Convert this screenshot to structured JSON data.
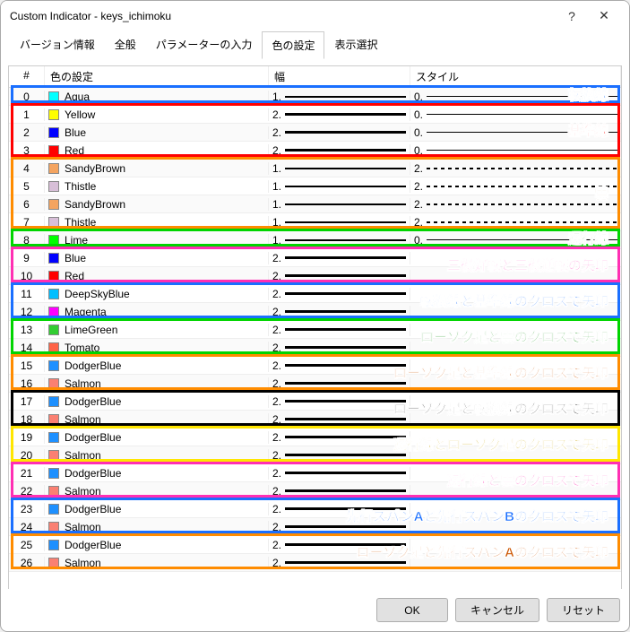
{
  "window": {
    "title": "Custom Indicator - keys_ichimoku"
  },
  "tabs": {
    "t0": "バージョン情報",
    "t1": "全般",
    "t2": "パラメーターの入力",
    "t3": "色の設定",
    "t4": "表示選択",
    "active": 3
  },
  "headers": {
    "num": "#",
    "color": "色の設定",
    "width": "幅",
    "style": "スタイル"
  },
  "rows": [
    {
      "n": "0",
      "name": "Aqua",
      "hex": "#00FFFF",
      "w": "1.",
      "wsz": 1,
      "s": "0.",
      "style": "solid"
    },
    {
      "n": "1",
      "name": "Yellow",
      "hex": "#FFFF00",
      "w": "2.",
      "wsz": 2,
      "s": "0.",
      "style": "solid"
    },
    {
      "n": "2",
      "name": "Blue",
      "hex": "#0000FF",
      "w": "2.",
      "wsz": 2,
      "s": "0.",
      "style": "solid"
    },
    {
      "n": "3",
      "name": "Red",
      "hex": "#FF0000",
      "w": "2.",
      "wsz": 2,
      "s": "0.",
      "style": "solid"
    },
    {
      "n": "4",
      "name": "SandyBrown",
      "hex": "#F4A460",
      "w": "1.",
      "wsz": 1,
      "s": "2.",
      "style": "dash"
    },
    {
      "n": "5",
      "name": "Thistle",
      "hex": "#D8BFD8",
      "w": "1.",
      "wsz": 1,
      "s": "2.",
      "style": "dash"
    },
    {
      "n": "6",
      "name": "SandyBrown",
      "hex": "#F4A460",
      "w": "1.",
      "wsz": 1,
      "s": "2.",
      "style": "dash"
    },
    {
      "n": "7",
      "name": "Thistle",
      "hex": "#D8BFD8",
      "w": "1.",
      "wsz": 1,
      "s": "2.",
      "style": "dash"
    },
    {
      "n": "8",
      "name": "Lime",
      "hex": "#00FF00",
      "w": "1.",
      "wsz": 1,
      "s": "0.",
      "style": "solid"
    },
    {
      "n": "9",
      "name": "Blue",
      "hex": "#0000FF",
      "w": "2.",
      "wsz": 2,
      "s": "",
      "style": ""
    },
    {
      "n": "10",
      "name": "Red",
      "hex": "#FF0000",
      "w": "2.",
      "wsz": 2,
      "s": "",
      "style": ""
    },
    {
      "n": "11",
      "name": "DeepSkyBlue",
      "hex": "#00BFFF",
      "w": "2.",
      "wsz": 2,
      "s": "",
      "style": ""
    },
    {
      "n": "12",
      "name": "Magenta",
      "hex": "#FF00FF",
      "w": "2.",
      "wsz": 2,
      "s": "",
      "style": ""
    },
    {
      "n": "13",
      "name": "LimeGreen",
      "hex": "#32CD32",
      "w": "2.",
      "wsz": 2,
      "s": "",
      "style": ""
    },
    {
      "n": "14",
      "name": "Tomato",
      "hex": "#FF6347",
      "w": "2.",
      "wsz": 2,
      "s": "",
      "style": ""
    },
    {
      "n": "15",
      "name": "DodgerBlue",
      "hex": "#1E90FF",
      "w": "2.",
      "wsz": 2,
      "s": "",
      "style": ""
    },
    {
      "n": "16",
      "name": "Salmon",
      "hex": "#FA8072",
      "w": "2.",
      "wsz": 2,
      "s": "",
      "style": ""
    },
    {
      "n": "17",
      "name": "DodgerBlue",
      "hex": "#1E90FF",
      "w": "2.",
      "wsz": 2,
      "s": "",
      "style": ""
    },
    {
      "n": "18",
      "name": "Salmon",
      "hex": "#FA8072",
      "w": "2.",
      "wsz": 2,
      "s": "",
      "style": ""
    },
    {
      "n": "19",
      "name": "DodgerBlue",
      "hex": "#1E90FF",
      "w": "2.",
      "wsz": 2,
      "s": "",
      "style": ""
    },
    {
      "n": "20",
      "name": "Salmon",
      "hex": "#FA8072",
      "w": "2.",
      "wsz": 2,
      "s": "",
      "style": ""
    },
    {
      "n": "21",
      "name": "DodgerBlue",
      "hex": "#1E90FF",
      "w": "2.",
      "wsz": 2,
      "s": "",
      "style": ""
    },
    {
      "n": "22",
      "name": "Salmon",
      "hex": "#FA8072",
      "w": "2.",
      "wsz": 2,
      "s": "",
      "style": ""
    },
    {
      "n": "23",
      "name": "DodgerBlue",
      "hex": "#1E90FF",
      "w": "2.",
      "wsz": 2,
      "s": "",
      "style": ""
    },
    {
      "n": "24",
      "name": "Salmon",
      "hex": "#FA8072",
      "w": "2.",
      "wsz": 2,
      "s": "",
      "style": ""
    },
    {
      "n": "25",
      "name": "DodgerBlue",
      "hex": "#1E90FF",
      "w": "2.",
      "wsz": 2,
      "s": "",
      "style": ""
    },
    {
      "n": "26",
      "name": "Salmon",
      "hex": "#FA8072",
      "w": "2.",
      "wsz": 2,
      "s": "",
      "style": ""
    }
  ],
  "groups": [
    {
      "label": "転換線",
      "color": "#1a6fff",
      "labelColor": "#1a6fff",
      "from": 0,
      "to": 0
    },
    {
      "label": "基準線",
      "color": "#ff0000",
      "labelColor": "#ff0000",
      "from": 1,
      "to": 3
    },
    {
      "label": "雲",
      "color": "#ff8c00",
      "labelColor": "#7a4a00",
      "from": 4,
      "to": 7
    },
    {
      "label": "遅行線",
      "color": "#00d400",
      "labelColor": "#008800",
      "from": 8,
      "to": 8
    },
    {
      "label": "三役好転と三役逆転の矢印",
      "color": "#ff2fb3",
      "labelColor": "#ff2fb3",
      "from": 9,
      "to": 10
    },
    {
      "label": "転換線と基準線のクロスで矢印",
      "color": "#1a6fff",
      "labelColor": "#1a6fff",
      "from": 11,
      "to": 12
    },
    {
      "label": "ローソク足と雲のクロスで矢印",
      "color": "#00d400",
      "labelColor": "#008800",
      "from": 13,
      "to": 14
    },
    {
      "label": "ローソク足と基準線のクロスで矢印",
      "color": "#ff8c00",
      "labelColor": "#cc5500",
      "from": 15,
      "to": 16
    },
    {
      "label": "ローソク足と転換線のクロスで矢印",
      "color": "#000000",
      "labelColor": "#000000",
      "from": 17,
      "to": 18
    },
    {
      "label": "遅行線とローソク足のクロスで矢印",
      "color": "#ffe600",
      "labelColor": "#c9a500",
      "from": 19,
      "to": 20
    },
    {
      "label": "遅行線と雲のクロスで矢印",
      "color": "#ff2fb3",
      "labelColor": "#ff2fb3",
      "from": 21,
      "to": 22
    },
    {
      "label": "先行スパンAと先行スパンBのクロスで矢印",
      "color": "#1a6fff",
      "labelColor": "#1a6fff",
      "from": 23,
      "to": 24
    },
    {
      "label": "ローソク足と先行スパンAのクロスで矢印",
      "color": "#ff8c00",
      "labelColor": "#cc5500",
      "from": 25,
      "to": 26
    }
  ],
  "buttons": {
    "ok": "OK",
    "cancel": "キャンセル",
    "reset": "リセット"
  }
}
